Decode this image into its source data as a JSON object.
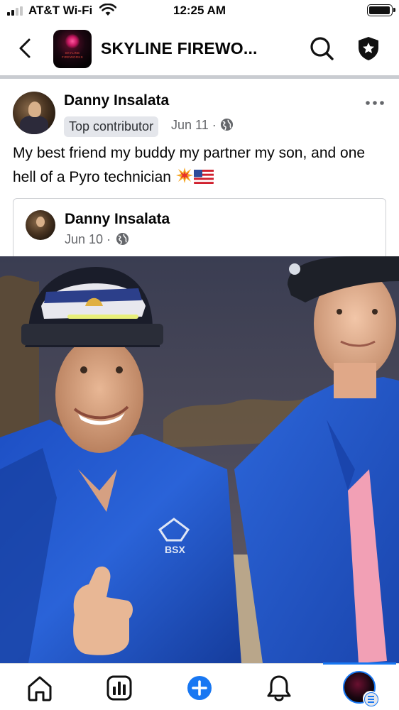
{
  "status_bar": {
    "carrier": "AT&T Wi-Fi",
    "time": "12:25 AM",
    "signal_bars_active": 2,
    "battery_level": 1.0
  },
  "header": {
    "title": "SKYLINE FIREWO...",
    "back_icon": "chevron-left-icon",
    "search_icon": "search-icon",
    "shield_icon": "shield-star-icon",
    "logo_text": "SKYLINE FIREWORKS"
  },
  "post": {
    "author": "Danny Insalata",
    "badge": "Top contributor",
    "date": "Jun 11",
    "separator": "·",
    "privacy_icon": "globe-icon",
    "text": "My best friend my buddy my partner my son, and one hell of a Pyro technician",
    "emojis": [
      "collision-emoji",
      "us-flag-emoji"
    ],
    "more_icon": "more-dots-icon"
  },
  "shared_post": {
    "author": "Danny Insalata",
    "date": "Jun 10",
    "separator": "·",
    "privacy_icon": "globe-icon"
  },
  "photo": {
    "description_icon": "post-photo",
    "jacket_brand": "BSX"
  },
  "bottom_nav": {
    "items": [
      {
        "name": "home",
        "icon": "home-icon"
      },
      {
        "name": "dashboard",
        "icon": "bar-chart-icon"
      },
      {
        "name": "create",
        "icon": "plus-circle-icon"
      },
      {
        "name": "notifications",
        "icon": "bell-icon"
      },
      {
        "name": "profile",
        "icon": "profile-avatar-icon",
        "active": true
      }
    ]
  },
  "colors": {
    "accent": "#1877f2",
    "secondary_text": "#65676b",
    "badge_bg": "#e4e6eb",
    "divider": "#c9ccd1"
  }
}
